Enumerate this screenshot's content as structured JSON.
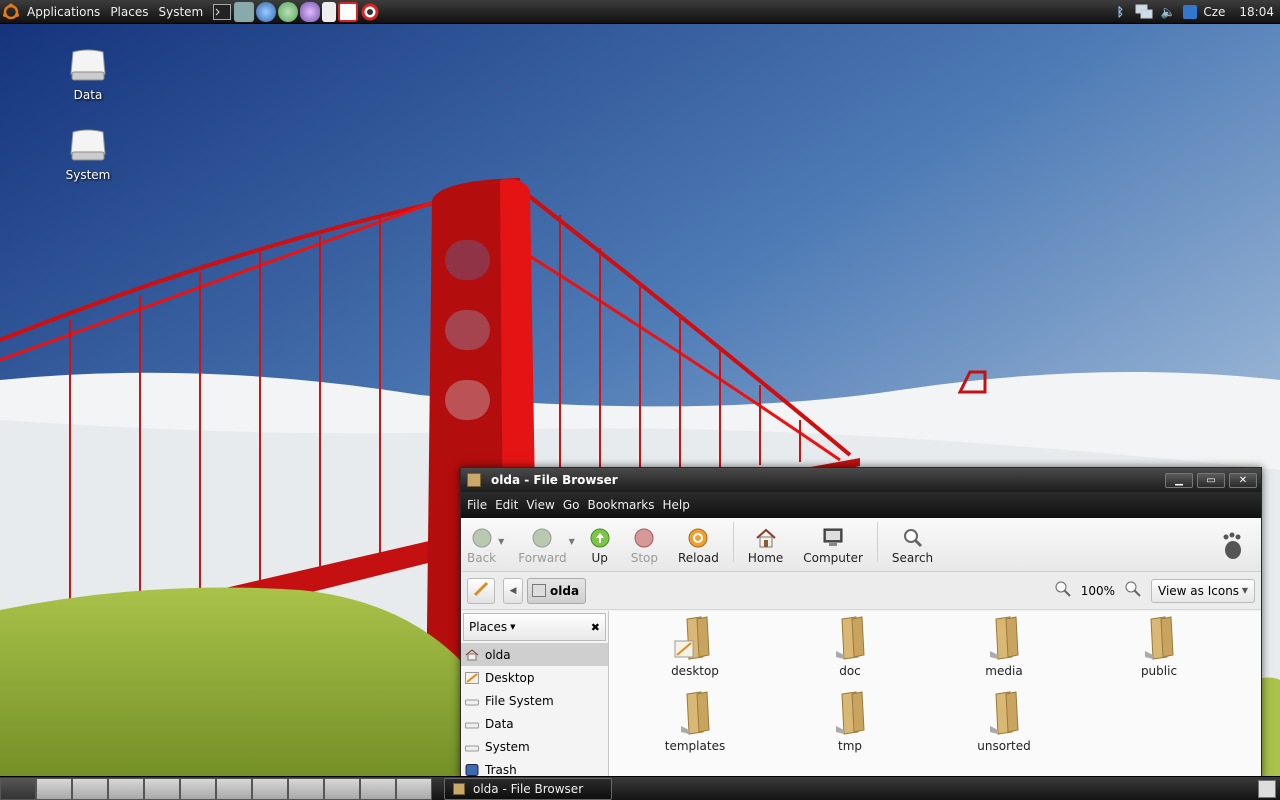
{
  "top_panel": {
    "menus": [
      "Applications",
      "Places",
      "System"
    ],
    "tray": {
      "keyboard_layout": "Cze",
      "clock": "18:04"
    }
  },
  "desktop_icons": [
    {
      "label": "Data"
    },
    {
      "label": "System"
    }
  ],
  "window": {
    "title": "olda - File Browser",
    "menus": [
      "File",
      "Edit",
      "View",
      "Go",
      "Bookmarks",
      "Help"
    ],
    "toolbar": {
      "back": "Back",
      "forward": "Forward",
      "up": "Up",
      "stop": "Stop",
      "reload": "Reload",
      "home": "Home",
      "computer": "Computer",
      "search": "Search"
    },
    "location": {
      "current": "olda",
      "zoom": "100%",
      "view_mode": "View as Icons"
    },
    "sidebar": {
      "header": "Places",
      "items": [
        "olda",
        "Desktop",
        "File System",
        "Data",
        "System",
        "Trash"
      ]
    },
    "files": [
      "desktop",
      "doc",
      "media",
      "public",
      "templates",
      "tmp",
      "unsorted"
    ]
  },
  "taskbar": {
    "task": "olda - File Browser"
  }
}
